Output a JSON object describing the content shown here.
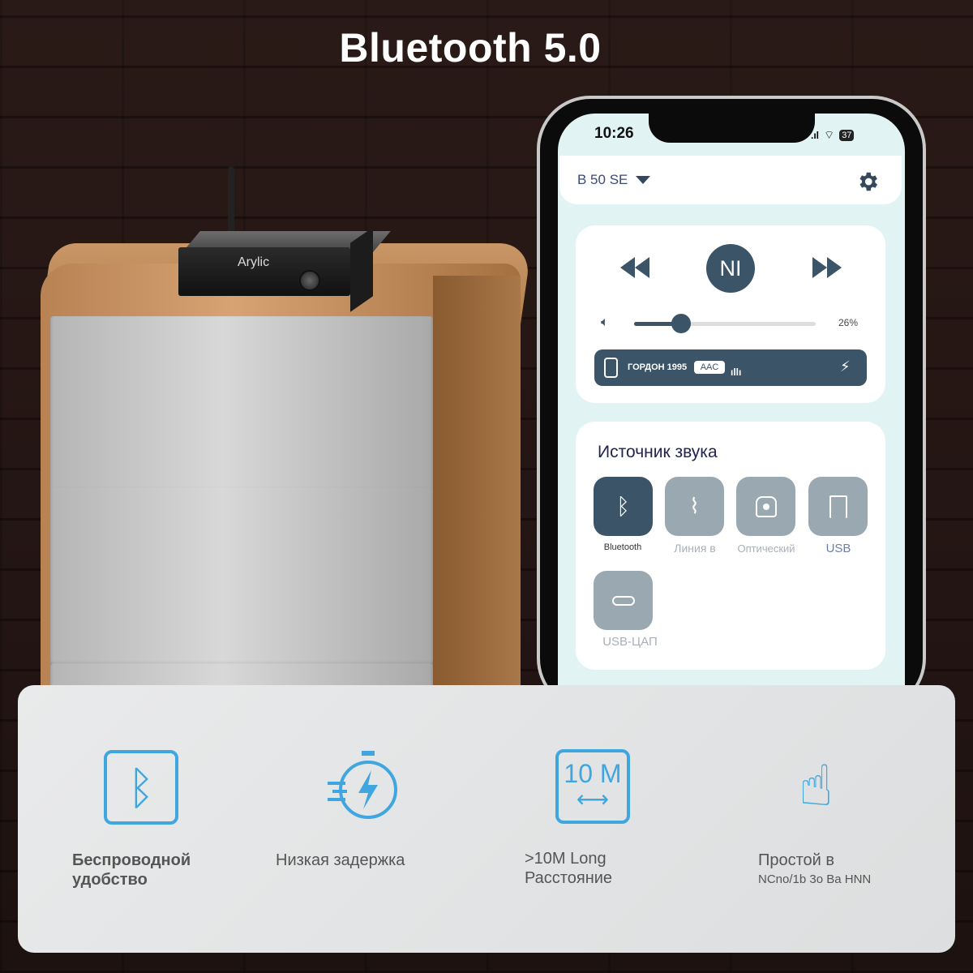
{
  "headline": "Bluetooth 5.0",
  "device": {
    "brand": "Arylic"
  },
  "phone": {
    "status": {
      "time": "10:26",
      "battery": "37"
    },
    "header": {
      "device_name": "B 50 SE"
    },
    "player": {
      "volume_percent": 26,
      "volume_label": "26%",
      "source_name": "ГОРДОН 1995",
      "codec": "AAC",
      "play_label": "NI"
    },
    "sources": {
      "title": "Источник звука",
      "items": [
        {
          "label": "Bluetooth",
          "icon": "bluetooth-icon",
          "active": true
        },
        {
          "label": "Линия в",
          "icon": "cable-icon",
          "active": false
        },
        {
          "label": "Оптический",
          "icon": "optical-icon",
          "active": false
        },
        {
          "label": "USB",
          "icon": "usb-icon",
          "active": false
        },
        {
          "label": "USB-ЦАП",
          "icon": "usb-c-icon",
          "active": false
        }
      ]
    }
  },
  "features": [
    {
      "line1": "Беспроводной",
      "line2": "удобство",
      "icon": "bluetooth-icon"
    },
    {
      "line1": "Низкая задержка",
      "line2": "",
      "icon": "stopwatch-lightning-icon"
    },
    {
      "line1": ">10M Long",
      "line2": "Расстояние",
      "icon": "range-icon",
      "icon_text": "10 M"
    },
    {
      "line1": "Простой в",
      "line2": "NCno/1b 3o Ba HNN",
      "icon": "hand-tap-icon"
    }
  ],
  "colors": {
    "accent": "#3b5468",
    "feature_icon": "#3fa6e0"
  }
}
